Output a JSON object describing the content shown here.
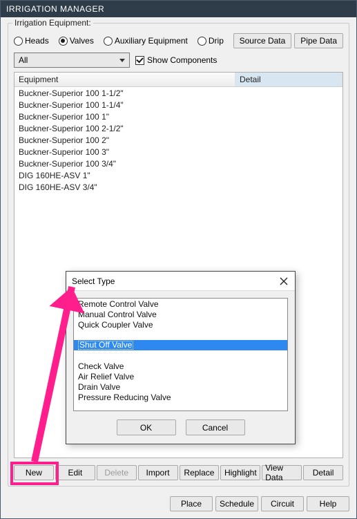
{
  "window": {
    "title": "IRRIGATION MANAGER"
  },
  "group": {
    "label": "Irrigation Equipment:"
  },
  "radios": {
    "heads": "Heads",
    "valves": "Valves",
    "aux": "Auxiliary Equipment",
    "drip": "Drip"
  },
  "topbtns": {
    "source": "Source Data",
    "pipe": "Pipe Data"
  },
  "filter": {
    "value": "All"
  },
  "showcomp": {
    "label": "Show Components"
  },
  "table": {
    "headers": {
      "equip": "Equipment",
      "detail": "Detail"
    },
    "rows": [
      "Buckner-Superior 100  1-1/2\"",
      "Buckner-Superior 100  1-1/4\"",
      "Buckner-Superior 100  1\"",
      "Buckner-Superior 100  2-1/2\"",
      "Buckner-Superior 100  2\"",
      "Buckner-Superior 100  3\"",
      "Buckner-Superior 100  3/4\"",
      "DIG 160HE-ASV  1\"",
      "DIG 160HE-ASV  3/4\""
    ]
  },
  "btns": {
    "new": "New",
    "edit": "Edit",
    "delete": "Delete",
    "import": "Import",
    "replace": "Replace",
    "highlight": "Highlight",
    "viewdata": "View Data",
    "detail": "Detail"
  },
  "footer": {
    "place": "Place",
    "schedule": "Schedule",
    "circuit": "Circuit",
    "help": "Help"
  },
  "popup": {
    "title": "Select Type",
    "items": [
      "Remote Control Valve",
      "Manual Control Valve",
      "Quick Coupler Valve",
      "",
      "Shut Off Valve",
      "",
      "Check Valve",
      "Air Relief Valve",
      "Drain Valve",
      "Pressure Reducing Valve"
    ],
    "selected_index": 4,
    "ok": "OK",
    "cancel": "Cancel"
  }
}
